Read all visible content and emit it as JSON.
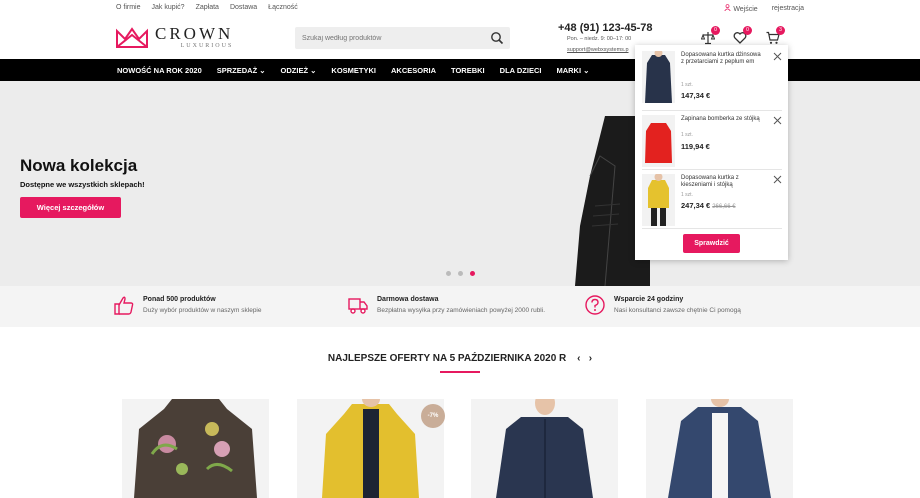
{
  "topbar": {
    "links": [
      "O firmie",
      "Jak kupić?",
      "Zapłata",
      "Dostawa",
      "Łączność"
    ],
    "login": "Wejście",
    "register": "rejestracja"
  },
  "header": {
    "logo_title": "CROWN",
    "logo_subtitle": "LUXURIOUS",
    "search_placeholder": "Szukaj według produktów",
    "phone": "+48 (91) 123-45-78",
    "hours": "Pon. – niedz. 9: 00–17: 00",
    "email": "support@webxsystems.p",
    "compare_count": "0",
    "wishlist_count": "0",
    "cart_count": "3"
  },
  "nav": {
    "items": [
      "NOWOŚĆ NA ROK 2020",
      "SPRZEDAŻ ⌄",
      "ODZIEŻ ⌄",
      "KOSMETYKI",
      "AKCESORIA",
      "TOREBKI",
      "DLA DZIECI",
      "MARKI ⌄"
    ]
  },
  "hero": {
    "title": "Nowa kolekcja",
    "subtitle": "Dostępne we wszystkich sklepach!",
    "button": "Więcej szczegółów",
    "active_slide": 3,
    "slide_count": 3
  },
  "features": [
    {
      "icon": "thumbs-up-icon",
      "title": "Ponad 500 produktów",
      "desc": "Duży wybór produktów w naszym sklepie"
    },
    {
      "icon": "truck-icon",
      "title": "Darmowa dostawa",
      "desc": "Bezpłatna wysyłka przy zamówieniach powyżej 2000 rubli."
    },
    {
      "icon": "question-icon",
      "title": "Wsparcie 24 godziny",
      "desc": "Nasi konsultanci zawsze chętnie Ci pomogą"
    }
  ],
  "offers": {
    "title": "NAJLEPSZE OFERTY NA 5 PAŹDZIERNIKA 2020 R",
    "prev": "‹",
    "next": "›",
    "discount_badge": "-7%"
  },
  "cart": {
    "items": [
      {
        "name": "Dopasowana kurtka dżinsowa z przetarciami z peplum em",
        "qty": "1 szt.",
        "price": "147,34 €",
        "old_price": ""
      },
      {
        "name": "Zapinana bomberka ze stójką",
        "qty": "1 szt.",
        "price": "119,94 €",
        "old_price": ""
      },
      {
        "name": "Dopasowana kurtka z kieszeniami i stójką",
        "qty": "1 szt.",
        "price": "247,34 €",
        "old_price": "266,66 €"
      }
    ],
    "button": "Sprawdzić"
  },
  "colors": {
    "accent": "#e6195f",
    "nav_bg": "#000000",
    "hero_bg": "#ececec"
  }
}
